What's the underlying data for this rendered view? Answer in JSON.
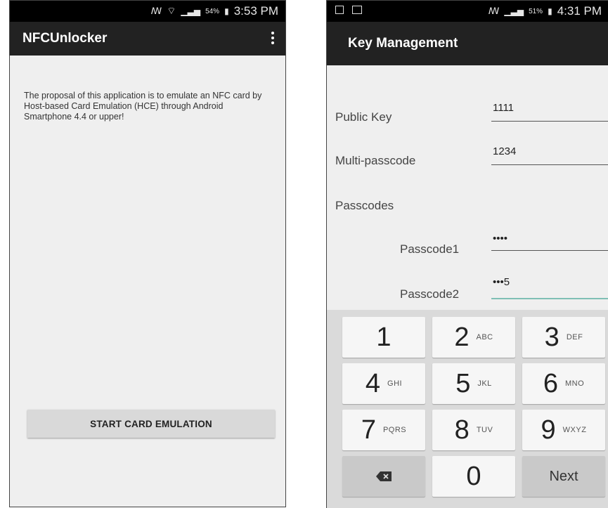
{
  "left_screen": {
    "status_bar": {
      "battery_pct": "54%",
      "time": "3:53 PM"
    },
    "app_title": "NFCUnlocker",
    "description": "The proposal of this application is to emulate an NFC card by Host-based Card Emulation (HCE) through Android Smartphone 4.4 or upper!",
    "start_button": "START CARD EMULATION"
  },
  "right_screen": {
    "status_bar": {
      "battery_pct": "51%",
      "time": "4:31 PM"
    },
    "app_title": "Key Management",
    "form": {
      "public_key_label": "Public Key",
      "public_key_value": "1111",
      "multi_passcode_label": "Multi-passcode",
      "multi_passcode_value": "1234",
      "passcodes_label": "Passcodes",
      "passcode1_label": "Passcode1",
      "passcode1_value": "••••",
      "passcode2_label": "Passcode2",
      "passcode2_value": "•••5"
    },
    "keyboard": {
      "keys": [
        {
          "digit": "1",
          "letters": ""
        },
        {
          "digit": "2",
          "letters": "ABC"
        },
        {
          "digit": "3",
          "letters": "DEF"
        },
        {
          "digit": "4",
          "letters": "GHI"
        },
        {
          "digit": "5",
          "letters": "JKL"
        },
        {
          "digit": "6",
          "letters": "MNO"
        },
        {
          "digit": "7",
          "letters": "PQRS"
        },
        {
          "digit": "8",
          "letters": "TUV"
        },
        {
          "digit": "9",
          "letters": "WXYZ"
        }
      ],
      "zero": "0",
      "next": "Next"
    }
  }
}
